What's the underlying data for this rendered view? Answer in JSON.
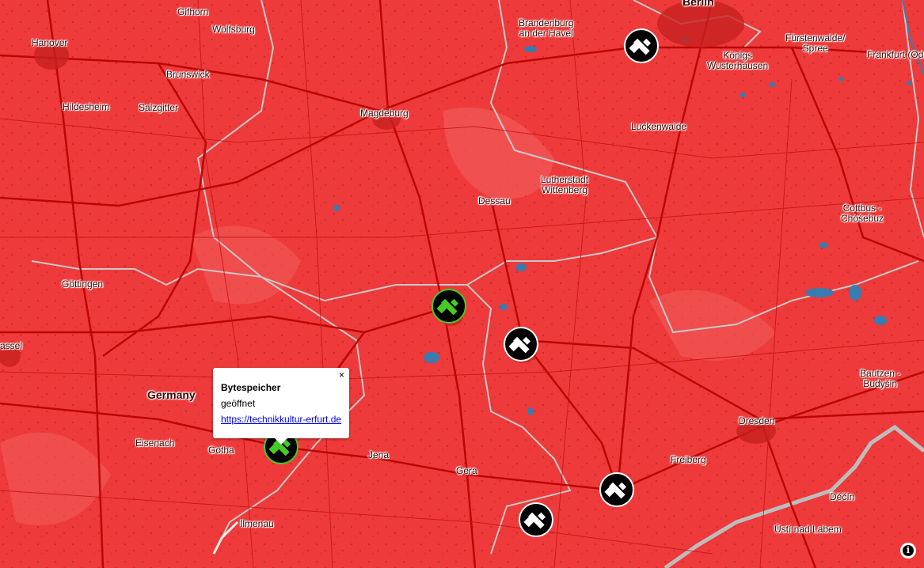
{
  "map": {
    "cities": [
      {
        "id": "berlin",
        "name": "Berlin"
      },
      {
        "id": "gifhorn",
        "name": "Gifhorn"
      },
      {
        "id": "wolfsburg",
        "name": "Wolfsburg"
      },
      {
        "id": "brandenburg",
        "name": "Brandenburg\nan der Havel"
      },
      {
        "id": "fuerstenwalde",
        "name": "Fürstenwalde/\nSpree"
      },
      {
        "id": "hanover",
        "name": "Hanover"
      },
      {
        "id": "koenigs",
        "name": "Königs\nWusterhausen"
      },
      {
        "id": "frankfurt",
        "name": "Frankfurt (Oder)"
      },
      {
        "id": "brunswick",
        "name": "Brunswick"
      },
      {
        "id": "hildesheim",
        "name": "Hildesheim"
      },
      {
        "id": "salzgitter",
        "name": "Salzgitter"
      },
      {
        "id": "magdeburg",
        "name": "Magdeburg"
      },
      {
        "id": "luckenwalde",
        "name": "Luckenwalde"
      },
      {
        "id": "wittenberg",
        "name": "Lutherstadt\nWittenberg"
      },
      {
        "id": "dessau",
        "name": "Dessau"
      },
      {
        "id": "cottbus",
        "name": "Cottbus -\nChóśebuz"
      },
      {
        "id": "goettingen",
        "name": "Göttingen"
      },
      {
        "id": "kassel",
        "name": "assel"
      },
      {
        "id": "germany",
        "name": "Germany"
      },
      {
        "id": "bautzen",
        "name": "Bautzen -\nBudyšin"
      },
      {
        "id": "dresden",
        "name": "Dresden"
      },
      {
        "id": "eisenach",
        "name": "Eisenach"
      },
      {
        "id": "gotha",
        "name": "Gotha"
      },
      {
        "id": "jena",
        "name": "Jena"
      },
      {
        "id": "freiberg",
        "name": "Freiberg"
      },
      {
        "id": "gera",
        "name": "Gera"
      },
      {
        "id": "decin",
        "name": "Děčín"
      },
      {
        "id": "ilmenau",
        "name": "Ilmenau"
      },
      {
        "id": "usti",
        "name": "Ústí nad Labem"
      }
    ],
    "markers": [
      {
        "id": "marker-berlin",
        "status": "closed"
      },
      {
        "id": "marker-halle",
        "status": "open"
      },
      {
        "id": "marker-leipzig",
        "status": "closed"
      },
      {
        "id": "marker-erfurt",
        "status": "open"
      },
      {
        "id": "marker-chemnitz",
        "status": "closed"
      },
      {
        "id": "marker-zwickau",
        "status": "closed"
      }
    ],
    "colors": {
      "background": "#ee3a3a",
      "roads": "#b80000",
      "border": "#c8c8c8",
      "water": "#3a7bb0",
      "open_marker": "#44cc22",
      "closed_marker": "#ffffff"
    }
  },
  "popup": {
    "close_label": "×",
    "title": "Bytespeicher",
    "status": "geöffnet",
    "link": "https://technikkultur-erfurt.de"
  },
  "attribution": {
    "icon": "info-icon",
    "label": "i"
  }
}
